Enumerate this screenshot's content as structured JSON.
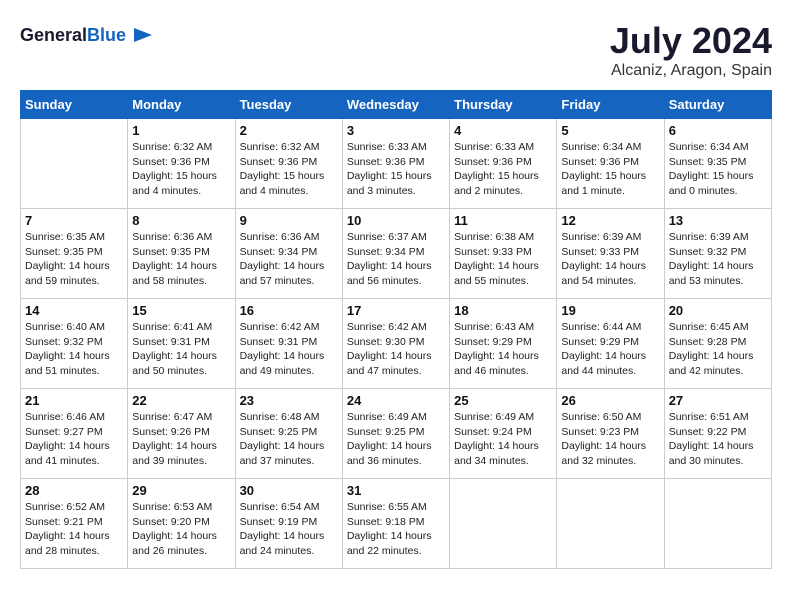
{
  "header": {
    "logo_line1": "General",
    "logo_line2": "Blue",
    "month_year": "July 2024",
    "location": "Alcaniz, Aragon, Spain"
  },
  "days_of_week": [
    "Sunday",
    "Monday",
    "Tuesday",
    "Wednesday",
    "Thursday",
    "Friday",
    "Saturday"
  ],
  "weeks": [
    [
      {
        "day": "",
        "sunrise": "",
        "sunset": "",
        "daylight": ""
      },
      {
        "day": "1",
        "sunrise": "Sunrise: 6:32 AM",
        "sunset": "Sunset: 9:36 PM",
        "daylight": "Daylight: 15 hours and 4 minutes."
      },
      {
        "day": "2",
        "sunrise": "Sunrise: 6:32 AM",
        "sunset": "Sunset: 9:36 PM",
        "daylight": "Daylight: 15 hours and 4 minutes."
      },
      {
        "day": "3",
        "sunrise": "Sunrise: 6:33 AM",
        "sunset": "Sunset: 9:36 PM",
        "daylight": "Daylight: 15 hours and 3 minutes."
      },
      {
        "day": "4",
        "sunrise": "Sunrise: 6:33 AM",
        "sunset": "Sunset: 9:36 PM",
        "daylight": "Daylight: 15 hours and 2 minutes."
      },
      {
        "day": "5",
        "sunrise": "Sunrise: 6:34 AM",
        "sunset": "Sunset: 9:36 PM",
        "daylight": "Daylight: 15 hours and 1 minute."
      },
      {
        "day": "6",
        "sunrise": "Sunrise: 6:34 AM",
        "sunset": "Sunset: 9:35 PM",
        "daylight": "Daylight: 15 hours and 0 minutes."
      }
    ],
    [
      {
        "day": "7",
        "sunrise": "Sunrise: 6:35 AM",
        "sunset": "Sunset: 9:35 PM",
        "daylight": "Daylight: 14 hours and 59 minutes."
      },
      {
        "day": "8",
        "sunrise": "Sunrise: 6:36 AM",
        "sunset": "Sunset: 9:35 PM",
        "daylight": "Daylight: 14 hours and 58 minutes."
      },
      {
        "day": "9",
        "sunrise": "Sunrise: 6:36 AM",
        "sunset": "Sunset: 9:34 PM",
        "daylight": "Daylight: 14 hours and 57 minutes."
      },
      {
        "day": "10",
        "sunrise": "Sunrise: 6:37 AM",
        "sunset": "Sunset: 9:34 PM",
        "daylight": "Daylight: 14 hours and 56 minutes."
      },
      {
        "day": "11",
        "sunrise": "Sunrise: 6:38 AM",
        "sunset": "Sunset: 9:33 PM",
        "daylight": "Daylight: 14 hours and 55 minutes."
      },
      {
        "day": "12",
        "sunrise": "Sunrise: 6:39 AM",
        "sunset": "Sunset: 9:33 PM",
        "daylight": "Daylight: 14 hours and 54 minutes."
      },
      {
        "day": "13",
        "sunrise": "Sunrise: 6:39 AM",
        "sunset": "Sunset: 9:32 PM",
        "daylight": "Daylight: 14 hours and 53 minutes."
      }
    ],
    [
      {
        "day": "14",
        "sunrise": "Sunrise: 6:40 AM",
        "sunset": "Sunset: 9:32 PM",
        "daylight": "Daylight: 14 hours and 51 minutes."
      },
      {
        "day": "15",
        "sunrise": "Sunrise: 6:41 AM",
        "sunset": "Sunset: 9:31 PM",
        "daylight": "Daylight: 14 hours and 50 minutes."
      },
      {
        "day": "16",
        "sunrise": "Sunrise: 6:42 AM",
        "sunset": "Sunset: 9:31 PM",
        "daylight": "Daylight: 14 hours and 49 minutes."
      },
      {
        "day": "17",
        "sunrise": "Sunrise: 6:42 AM",
        "sunset": "Sunset: 9:30 PM",
        "daylight": "Daylight: 14 hours and 47 minutes."
      },
      {
        "day": "18",
        "sunrise": "Sunrise: 6:43 AM",
        "sunset": "Sunset: 9:29 PM",
        "daylight": "Daylight: 14 hours and 46 minutes."
      },
      {
        "day": "19",
        "sunrise": "Sunrise: 6:44 AM",
        "sunset": "Sunset: 9:29 PM",
        "daylight": "Daylight: 14 hours and 44 minutes."
      },
      {
        "day": "20",
        "sunrise": "Sunrise: 6:45 AM",
        "sunset": "Sunset: 9:28 PM",
        "daylight": "Daylight: 14 hours and 42 minutes."
      }
    ],
    [
      {
        "day": "21",
        "sunrise": "Sunrise: 6:46 AM",
        "sunset": "Sunset: 9:27 PM",
        "daylight": "Daylight: 14 hours and 41 minutes."
      },
      {
        "day": "22",
        "sunrise": "Sunrise: 6:47 AM",
        "sunset": "Sunset: 9:26 PM",
        "daylight": "Daylight: 14 hours and 39 minutes."
      },
      {
        "day": "23",
        "sunrise": "Sunrise: 6:48 AM",
        "sunset": "Sunset: 9:25 PM",
        "daylight": "Daylight: 14 hours and 37 minutes."
      },
      {
        "day": "24",
        "sunrise": "Sunrise: 6:49 AM",
        "sunset": "Sunset: 9:25 PM",
        "daylight": "Daylight: 14 hours and 36 minutes."
      },
      {
        "day": "25",
        "sunrise": "Sunrise: 6:49 AM",
        "sunset": "Sunset: 9:24 PM",
        "daylight": "Daylight: 14 hours and 34 minutes."
      },
      {
        "day": "26",
        "sunrise": "Sunrise: 6:50 AM",
        "sunset": "Sunset: 9:23 PM",
        "daylight": "Daylight: 14 hours and 32 minutes."
      },
      {
        "day": "27",
        "sunrise": "Sunrise: 6:51 AM",
        "sunset": "Sunset: 9:22 PM",
        "daylight": "Daylight: 14 hours and 30 minutes."
      }
    ],
    [
      {
        "day": "28",
        "sunrise": "Sunrise: 6:52 AM",
        "sunset": "Sunset: 9:21 PM",
        "daylight": "Daylight: 14 hours and 28 minutes."
      },
      {
        "day": "29",
        "sunrise": "Sunrise: 6:53 AM",
        "sunset": "Sunset: 9:20 PM",
        "daylight": "Daylight: 14 hours and 26 minutes."
      },
      {
        "day": "30",
        "sunrise": "Sunrise: 6:54 AM",
        "sunset": "Sunset: 9:19 PM",
        "daylight": "Daylight: 14 hours and 24 minutes."
      },
      {
        "day": "31",
        "sunrise": "Sunrise: 6:55 AM",
        "sunset": "Sunset: 9:18 PM",
        "daylight": "Daylight: 14 hours and 22 minutes."
      },
      {
        "day": "",
        "sunrise": "",
        "sunset": "",
        "daylight": ""
      },
      {
        "day": "",
        "sunrise": "",
        "sunset": "",
        "daylight": ""
      },
      {
        "day": "",
        "sunrise": "",
        "sunset": "",
        "daylight": ""
      }
    ]
  ]
}
